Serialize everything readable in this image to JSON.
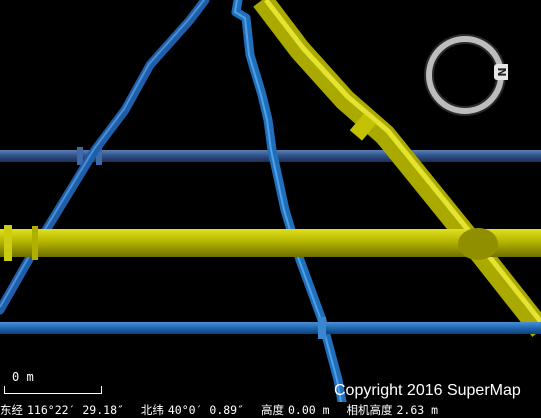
{
  "viewer": {
    "compass_letter": "N",
    "scale": {
      "label": "0 m"
    },
    "copyright": "Copyright 2016 SuperMap",
    "status": {
      "longitude_label": "东经",
      "longitude_value": "116°22′ 29.18″",
      "latitude_label": "北纬",
      "latitude_value": "40°0′ 0.89″",
      "altitude_label": "高度",
      "altitude_value": "0.00 m",
      "camera_label": "相机高度",
      "camera_value": "2.63 m"
    }
  },
  "colors": {
    "background": "#000000",
    "pipe_blue": "#1b5fa8",
    "pipe_blue_light": "#2a78c4",
    "pipe_yellow": "#b8b800",
    "pipe_yellow_dark": "#8f8f00",
    "compass_ring": "#bdbdbd"
  }
}
